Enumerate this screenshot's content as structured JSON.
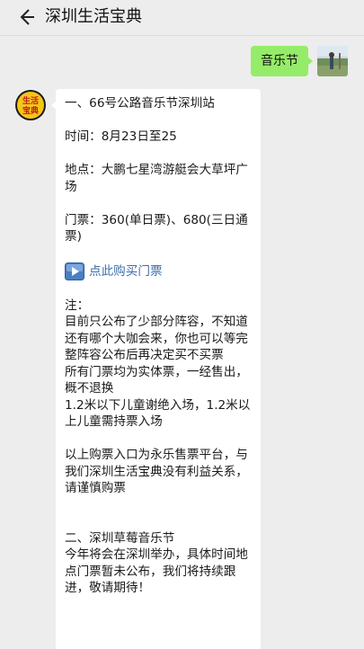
{
  "header": {
    "title": "深圳生活宝典"
  },
  "chat": {
    "user_message": "音乐节",
    "reply": {
      "section1_title": "一、66号公路音乐节深圳站",
      "time": "时间：8月23日至25",
      "location": "地点：大鹏七星湾游艇会大草坪广场",
      "tickets": "门票：360(单日票)、680(三日通票)",
      "buy_link": "点此购买门票",
      "note_label": "注：",
      "note_1": "目前只公布了少部分阵容，不知道还有哪个大咖会来，你也可以等完整阵容公布后再决定买不买票",
      "note_2": "所有门票均为实体票，一经售出，概不退换",
      "note_3": "1.2米以下儿童谢绝入场，1.2米以上儿童需持票入场",
      "disclaimer": "以上购票入口为永乐售票平台，与我们深圳生活宝典没有利益关系，请谨慎购票",
      "section2_title": "二、深圳草莓音乐节",
      "section2_body": "今年将会在深圳举办，具体时间地点门票暂未公布，我们将持续跟进，敬请期待！"
    }
  },
  "colors": {
    "background": "#ededed",
    "user_bubble": "#95ec69",
    "link": "#3d6ea8",
    "logo_bg": "#f5c518"
  },
  "icons": {
    "back": "back-arrow-icon",
    "play": "play-icon",
    "bot_logo_text": "生活宝典"
  }
}
